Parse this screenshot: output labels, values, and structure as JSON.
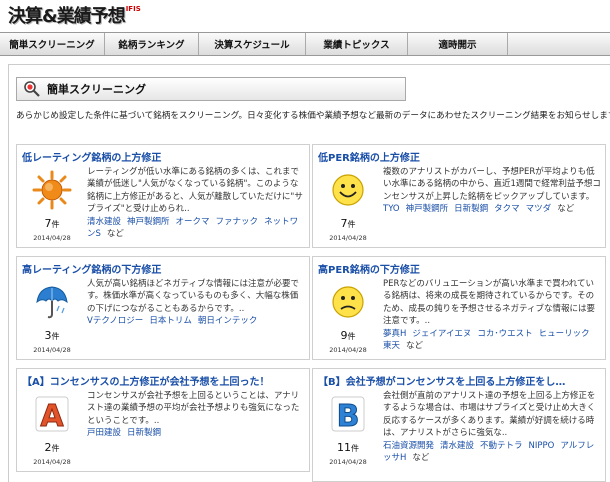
{
  "logo": {
    "main": "決算&業績予想",
    "sub": "IFIS"
  },
  "nav": [
    "簡単スクリーニング",
    "銘柄ランキング",
    "決算スケジュール",
    "業績トピックス",
    "適時開示"
  ],
  "section": {
    "title": "簡単スクリーニング"
  },
  "intro": "あらかじめ設定した条件に基づいて銘柄をスクリーニング。日々変化する株価や業績予想など最新のデータにあわせたスクリーニング結果をお知らせします。",
  "cards": [
    {
      "title": "低レーティング銘柄の上方修正",
      "icon": "sun-icon",
      "count": "7",
      "unit": "件",
      "date": "2014/04/28",
      "desc": "レーティングが低い水準にある銘柄の多くは、これまで業績が低迷し\"人気がなくなっている銘柄\"。このような銘柄に上方修正があると、人気が離散していただけに\"サプライズ\"と受け止められ..",
      "links": [
        "清水建設",
        "神戸製鋼所",
        "オークマ",
        "ファナック",
        "ネットワンS"
      ],
      "etc": "など"
    },
    {
      "title": "低PER銘柄の上方修正",
      "icon": "smiley-icon",
      "count": "7",
      "unit": "件",
      "date": "2014/04/28",
      "desc": "複数のアナリストがカバーし、予想PERが平均よりも低い水準にある銘柄の中から、直近1週間で経常利益予想コンセンサスが上昇した銘柄をピックアップしています。",
      "links": [
        "TYO",
        "神戸製鋼所",
        "日新製鋼",
        "タクマ",
        "マツダ"
      ],
      "etc": "など"
    },
    {
      "title": "高レーティング銘柄の下方修正",
      "icon": "umbrella-icon",
      "count": "3",
      "unit": "件",
      "date": "2014/04/28",
      "desc": "人気が高い銘柄ほどネガティブな情報には注意が必要です。株価水準が高くなっているものも多く、大幅な株価の下げにつながることもあるからです。..",
      "links": [
        "Vテクノロジー",
        "日本トリム",
        "朝日インテック"
      ],
      "etc": ""
    },
    {
      "title": "高PER銘柄の下方修正",
      "icon": "worried-face-icon",
      "count": "9",
      "unit": "件",
      "date": "2014/04/28",
      "desc": "PERなどのバリュエーションが高い水準まで買われている銘柄は、将来の成長を期待されているからです。そのため、成長の鈍りを予想させるネガティブな情報には要注意です。..",
      "links": [
        "夢真H",
        "ジェイアイエヌ",
        "コカ･ウエスト",
        "ヒューリック",
        "東天"
      ],
      "etc": "など"
    },
    {
      "title": "【A】コンセンサスの上方修正が会社予想を上回った！",
      "icon": "letter-a-icon",
      "count": "2",
      "unit": "件",
      "date": "2014/04/28",
      "desc": "コンセンサスが会社予想を上回るということは、アナリスト達の業績予想の平均が会社予想よりも強気になったということです。..",
      "links": [
        "戸田建設",
        "日新製鋼"
      ],
      "etc": ""
    },
    {
      "title": "【B】会社予想がコンセンサスを上回る上方修正をし…",
      "icon": "letter-b-icon",
      "count": "11",
      "unit": "件",
      "date": "2014/04/28",
      "desc": "会社側が直前のアナリスト達の予想を上回る上方修正をするような場合は、市場はサプライズと受け止め大きく反応するケースが多くあります。業績が好調を続ける時は、アナリストがさらに強気な..",
      "links": [
        "石油資源開発",
        "清水建設",
        "不動テトラ",
        "NIPPO",
        "アルフレッサH"
      ],
      "etc": "など"
    }
  ]
}
